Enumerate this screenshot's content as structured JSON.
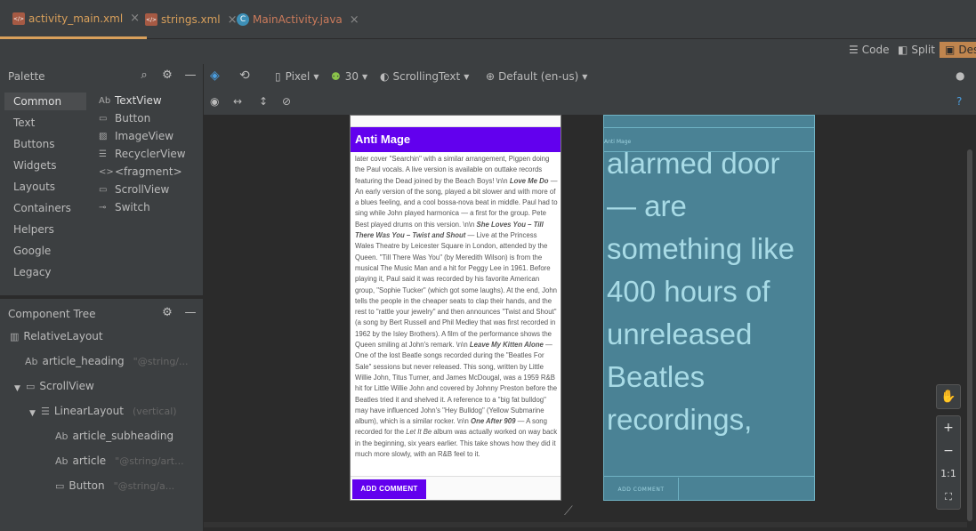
{
  "tabs": [
    {
      "label": "activity_main.xml",
      "icon": "xml-file-icon",
      "active": true
    },
    {
      "label": "strings.xml",
      "icon": "xml-file-icon",
      "active": false
    },
    {
      "label": "MainActivity.java",
      "icon": "java-class-icon",
      "active": false
    }
  ],
  "view_modes": {
    "code": "Code",
    "split": "Split",
    "design": "Des"
  },
  "palette": {
    "title": "Palette",
    "categories": [
      "Common",
      "Text",
      "Buttons",
      "Widgets",
      "Layouts",
      "Containers",
      "Helpers",
      "Google",
      "Legacy"
    ],
    "widgets": [
      {
        "label": "TextView",
        "icon": "Ab"
      },
      {
        "label": "Button",
        "icon": "▭"
      },
      {
        "label": "ImageView",
        "icon": "▨"
      },
      {
        "label": "RecyclerView",
        "icon": "☰"
      },
      {
        "label": "<fragment>",
        "icon": "<>"
      },
      {
        "label": "ScrollView",
        "icon": "▭"
      },
      {
        "label": "Switch",
        "icon": "⊸"
      }
    ]
  },
  "component_tree": {
    "title": "Component Tree",
    "nodes": [
      {
        "label": "RelativeLayout",
        "hint": "",
        "icon": "▥"
      },
      {
        "label": "article_heading",
        "hint": "\"@string/...",
        "icon": "Ab"
      },
      {
        "label": "ScrollView",
        "hint": "",
        "icon": "▭"
      },
      {
        "label": "LinearLayout",
        "hint": "(vertical)",
        "icon": "☰"
      },
      {
        "label": "article_subheading",
        "hint": "",
        "icon": "Ab"
      },
      {
        "label": "article",
        "hint": "\"@string/art...",
        "icon": "Ab"
      },
      {
        "label": "Button",
        "hint": "\"@string/a...",
        "icon": "▭"
      }
    ]
  },
  "design_toolbar": {
    "device": "Pixel",
    "api": "30",
    "theme": "ScrollingText",
    "locale": "Default (en-us)"
  },
  "preview": {
    "heading": "Anti Mage",
    "article_html": "later cover \"Searchin\" with a similar arrangement, Pigpen doing the Paul vocals. A live version is available on outtake records featuring the Dead joined by the Beach Boys! \\n\\n <i>Love Me Do</i> — An early version of the song, played a bit slower and with more of a blues feeling, and a cool bossa-nova beat in middle. Paul had to sing while John played harmonica — a first for the group. Pete Best played drums on this version. \\n\\n <i>She Loves You – Till There Was You – Twist and Shout</i> — Live at the Princess Wales Theatre by Leicester Square in London, attended by the Queen. \"Till There Was You\" (by Meredith Wilson) is from the musical The Music Man and a hit for Peggy Lee in 1961. Before playing it, Paul said it was recorded by his favorite American group, \"Sophie Tucker\" (which got some laughs). At the end, John tells the people in the cheaper seats to clap their hands, and the rest to \"rattle your jewelry\" and then announces \"Twist and Shout\" (a song by Bert Russell and Phil Medley that was first recorded in 1962 by the Isley Brothers). A film of the performance shows the Queen smiling at John's remark. \\n\\n <i>Leave My Kitten Alone</i> — One of the lost Beatle songs recorded during the \"Beatles For Sale\" sessions but never released. This song, written by Little Willie John, Titus Turner, and James McDougal, was a 1959 R&B hit for Little Willie John and covered by Johnny Preston before the Beatles tried it and shelved it. A reference to a \"big fat bulldog\" may have influenced John's \"Hey Bulldog\" (Yellow Submarine album), which is a similar rocker. \\n\\n <i>One After 909</i> — A song recorded for the <em>Let It Be</em> album was actually worked on way back in the beginning, six years earlier. This take shows how they did it much more slowly, with an R&B feel to it.",
    "button": "ADD COMMENT"
  },
  "blueprint": {
    "heading": "Anti Mage",
    "text": "alarmed door — are something like 400 hours of unreleased Beatles recordings,",
    "button": "ADD COMMENT"
  },
  "zoom": {
    "fit_label": "1:1"
  }
}
